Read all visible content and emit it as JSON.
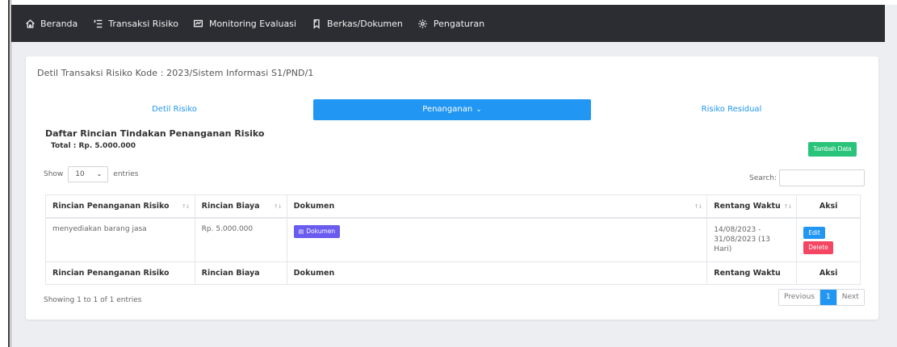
{
  "nav": {
    "items": [
      {
        "label": "Beranda",
        "icon": "home-icon"
      },
      {
        "label": "Transaksi Risiko",
        "icon": "list-icon"
      },
      {
        "label": "Monitoring Evaluasi",
        "icon": "monitor-icon"
      },
      {
        "label": "Berkas/Dokumen",
        "icon": "file-icon"
      },
      {
        "label": "Pengaturan",
        "icon": "gear-icon"
      }
    ]
  },
  "card": {
    "title": "Detil Transaksi Risiko Kode : 2023/Sistem Informasi S1/PND/1"
  },
  "tabs": {
    "detil": "Detil Risiko",
    "penanganan": "Penanganan",
    "residual": "Risiko Residual"
  },
  "section": {
    "title": "Daftar Rincian Tindakan Penanganan Risiko",
    "total": "Total : Rp. 5.000.000",
    "add_button": "Tambah Data"
  },
  "controls": {
    "show_label": "Show",
    "entries_value": "10",
    "entries_label": "entries",
    "search_label": "Search:",
    "search_value": ""
  },
  "table": {
    "headers": [
      "Rincian Penanganan Risiko",
      "Rincian Biaya",
      "Dokumen",
      "Rentang Waktu",
      "Aksi"
    ],
    "rows": [
      {
        "rincian": "menyediakan barang jasa",
        "biaya": "Rp. 5.000.000",
        "dokumen_button": "Dokumen",
        "rentang_1": "14/08/2023 -",
        "rentang_2": "31/08/2023 (13",
        "rentang_3": "Hari)",
        "edit": "Edit",
        "delete": "Delete"
      }
    ]
  },
  "footer": {
    "info": "Showing 1 to 1 of 1 entries",
    "previous": "Previous",
    "page": "1",
    "next": "Next"
  },
  "colors": {
    "nav_bg": "#2c2c33",
    "primary": "#2196f3",
    "success": "#29c479",
    "danger": "#f44562",
    "doc_button": "#6b5cf0"
  }
}
